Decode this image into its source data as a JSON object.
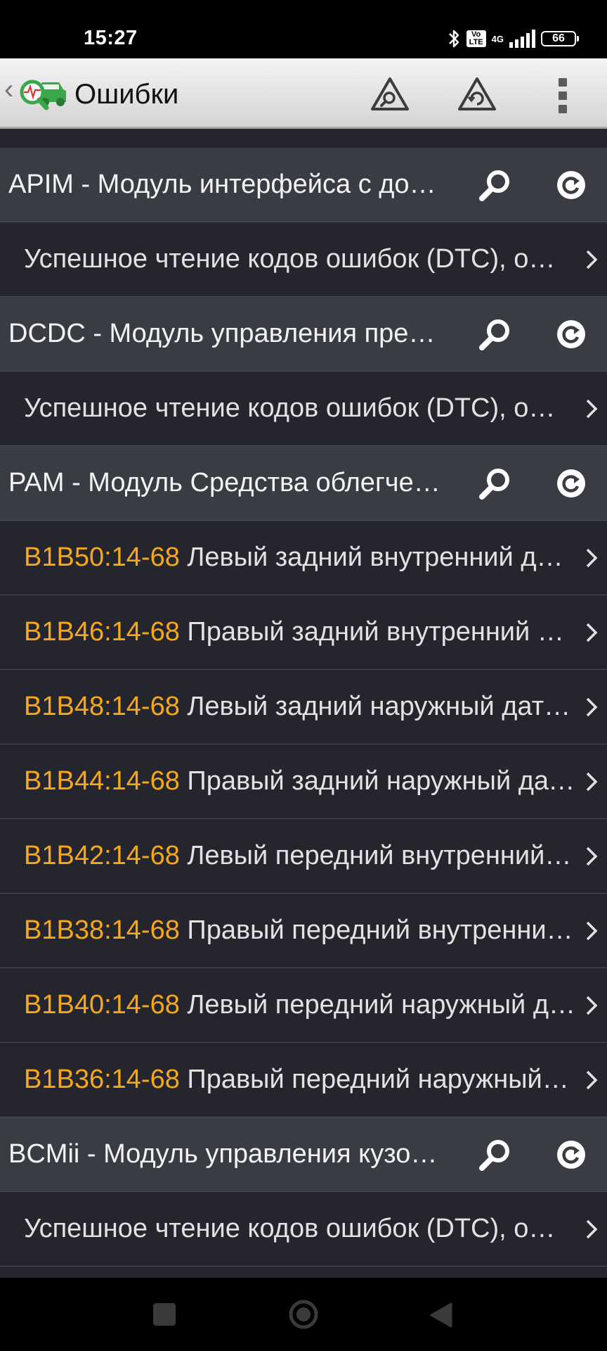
{
  "status_bar": {
    "time": "15:27",
    "icons": [
      "bluetooth-icon",
      "volte-icon",
      "4g-icon",
      "signal-icon",
      "battery-icon"
    ],
    "volte_label": "Vo LTE",
    "network": "4G",
    "battery": "66"
  },
  "toolbar": {
    "back_glyph": "‹",
    "title": "Ошибки",
    "actions": [
      "scan-warning-icon",
      "clear-warning-icon",
      "overflow-menu-icon"
    ]
  },
  "colors": {
    "background": "#24252d",
    "module_row": "#3a3c44",
    "dtc_code": "#f6a81a",
    "text": "#e2e2e2"
  },
  "rows": [
    {
      "kind": "module",
      "label": "APIM - Модуль интерфейса с дополнительными устройствами"
    },
    {
      "kind": "status",
      "label": "Успешное чтение кодов ошибок (DTC), ошибок не найдено"
    },
    {
      "kind": "module",
      "label": "DCDC - Модуль управления преобразователем постоянного тока"
    },
    {
      "kind": "status",
      "label": "Успешное чтение кодов ошибок (DTC), ошибок не найдено"
    },
    {
      "kind": "module",
      "label": "PAM - Модуль Средства облегчения парковки"
    },
    {
      "kind": "dtc",
      "code": "B1B50:14-68",
      "label": "Левый задний внутренний датчик"
    },
    {
      "kind": "dtc",
      "code": "B1B46:14-68",
      "label": "Правый задний внутренний датчик"
    },
    {
      "kind": "dtc",
      "code": "B1B48:14-68",
      "label": "Левый задний наружный датчик"
    },
    {
      "kind": "dtc",
      "code": "B1B44:14-68",
      "label": "Правый задний наружный датчик"
    },
    {
      "kind": "dtc",
      "code": "B1B42:14-68",
      "label": "Левый передний внутренний датчик"
    },
    {
      "kind": "dtc",
      "code": "B1B38:14-68",
      "label": "Правый передний внутренний датчик"
    },
    {
      "kind": "dtc",
      "code": "B1B40:14-68",
      "label": "Левый передний наружный датчик"
    },
    {
      "kind": "dtc",
      "code": "B1B36:14-68",
      "label": "Правый передний наружный датчик"
    },
    {
      "kind": "module",
      "label": "BCMii - Модуль управления кузовом"
    },
    {
      "kind": "status",
      "label": "Успешное чтение кодов ошибок (DTC), ошибок не найдено"
    }
  ],
  "nav_bar": {
    "buttons": [
      "recents-button",
      "home-button",
      "back-button"
    ]
  }
}
